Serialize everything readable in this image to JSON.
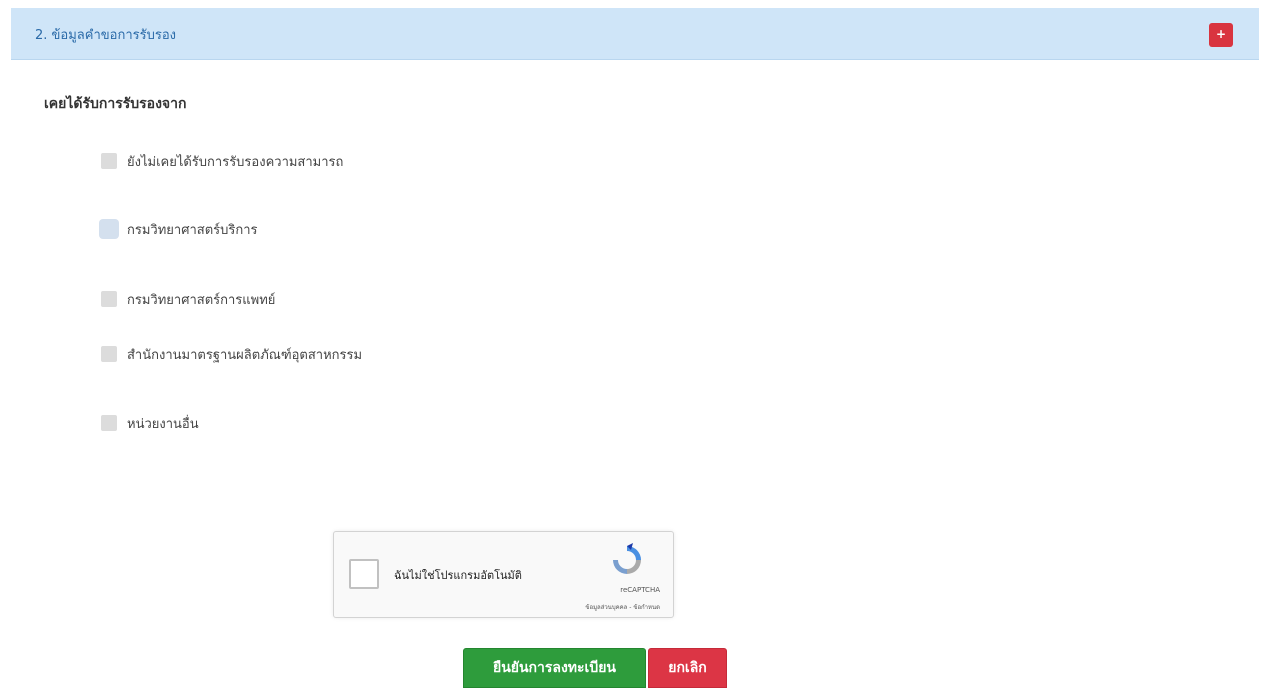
{
  "section": {
    "title": "2. ข้อมูลคำขอการรับรอง",
    "toggle_label": "+"
  },
  "accreditation": {
    "group_label": "เคยได้รับการรับรองจาก",
    "options": [
      {
        "label": "ยังไม่เคยได้รับการรับรองความสามารถ",
        "checked": false
      },
      {
        "label": "กรมวิทยาศาสตร์บริการ",
        "checked": false
      },
      {
        "label": "กรมวิทยาศาสตร์การแพทย์",
        "checked": false
      },
      {
        "label": "สำนักงานมาตรฐานผลิตภัณฑ์อุตสาหกรรม",
        "checked": false
      },
      {
        "label": "หน่วยงานอื่น",
        "checked": false
      }
    ]
  },
  "captcha": {
    "label": "ฉันไม่ใช่โปรแกรมอัตโนมัติ",
    "brand": "reCAPTCHA",
    "links": "ข้อมูลส่วนบุคคล - ข้อกำหนด"
  },
  "actions": {
    "confirm_label": "ยืนยันการลงทะเบียน",
    "cancel_label": "ยกเลิก"
  },
  "colors": {
    "header_bg": "#cfe5f8",
    "header_text": "#2a6aa8",
    "toggle": "#d9343f",
    "confirm": "#2e9c3c",
    "cancel": "#dc3545"
  }
}
